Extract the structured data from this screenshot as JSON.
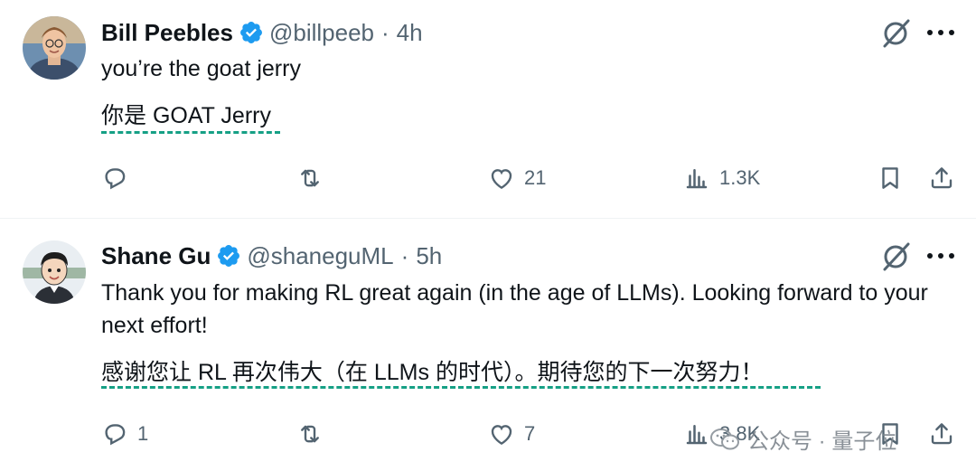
{
  "tweets": [
    {
      "name": "Bill Peebles",
      "handle": "@billpeeb",
      "separator": "·",
      "time": "4h",
      "text": "you’re the goat jerry",
      "translation": "你是 GOAT Jerry",
      "replies": "",
      "retweets": "",
      "likes": "21",
      "views": "1.3K"
    },
    {
      "name": "Shane Gu",
      "handle": "@shaneguML",
      "separator": "·",
      "time": "5h",
      "text": "Thank you for making RL great again (in the age of LLMs). Looking forward to your next effort!",
      "translation": "感谢您让 RL 再次伟大（在 LLMs 的时代）。期待您的下一次努力！",
      "replies": "1",
      "retweets": "",
      "likes": "7",
      "views": "3.8K"
    }
  ],
  "watermark": "公众号 · 量子位",
  "colors": {
    "verified": "#1d9bf0",
    "icon": "#536471",
    "underline": "#16a085"
  },
  "icons": [
    "reply-icon",
    "retweet-icon",
    "like-icon",
    "views-icon",
    "bookmark-icon",
    "share-icon",
    "grok-icon",
    "more-icon",
    "verified-badge-icon",
    "wechat-icon"
  ]
}
